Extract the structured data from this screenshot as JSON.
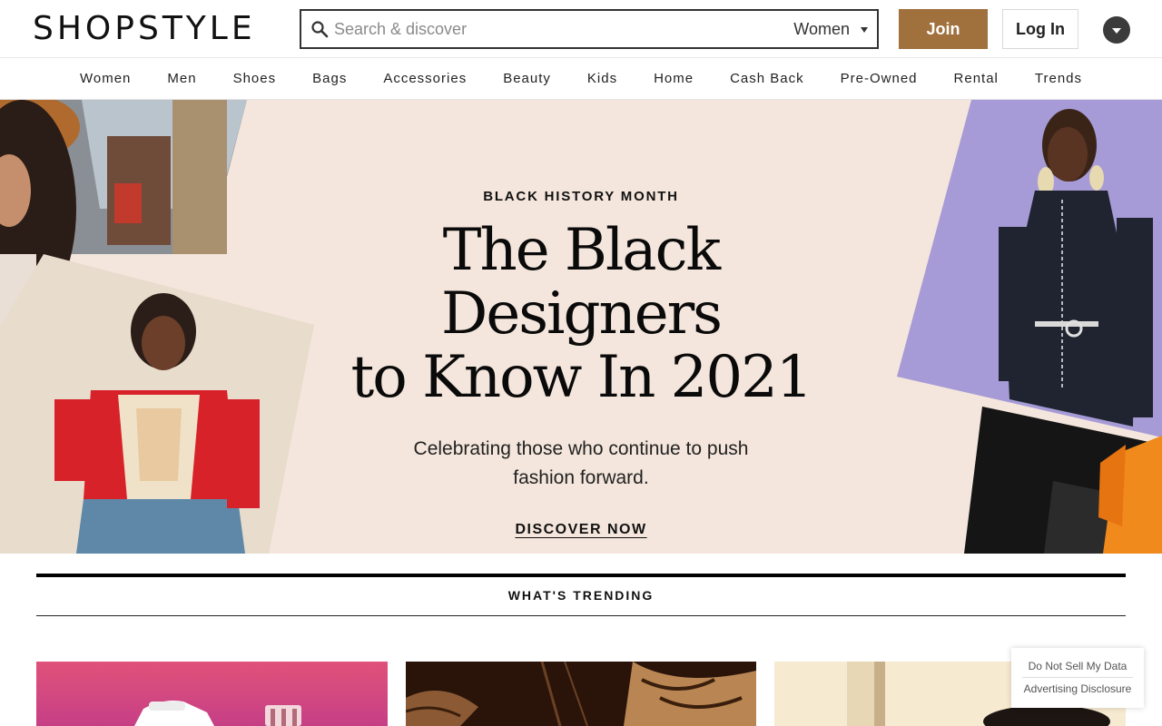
{
  "header": {
    "logo": "SHOPSTYLE",
    "search_placeholder": "Search & discover",
    "search_scope": "Women",
    "join_label": "Join",
    "login_label": "Log In"
  },
  "nav": {
    "items": [
      "Women",
      "Men",
      "Shoes",
      "Bags",
      "Accessories",
      "Beauty",
      "Kids",
      "Home",
      "Cash Back",
      "Pre-Owned",
      "Rental",
      "Trends"
    ]
  },
  "hero": {
    "eyebrow": "BLACK HISTORY MONTH",
    "headline_line1": "The Black Designers",
    "headline_line2": "to Know In 2021",
    "subhead": "Celebrating those who continue to push fashion forward.",
    "cta": "DISCOVER NOW",
    "background_color": "#f4e6dc"
  },
  "trending": {
    "title": "WHAT'S TRENDING"
  },
  "privacy": {
    "do_not_sell": "Do Not Sell My Data",
    "advertising": "Advertising Disclosure"
  },
  "colors": {
    "join_button": "#a0703d",
    "text": "#111111"
  }
}
